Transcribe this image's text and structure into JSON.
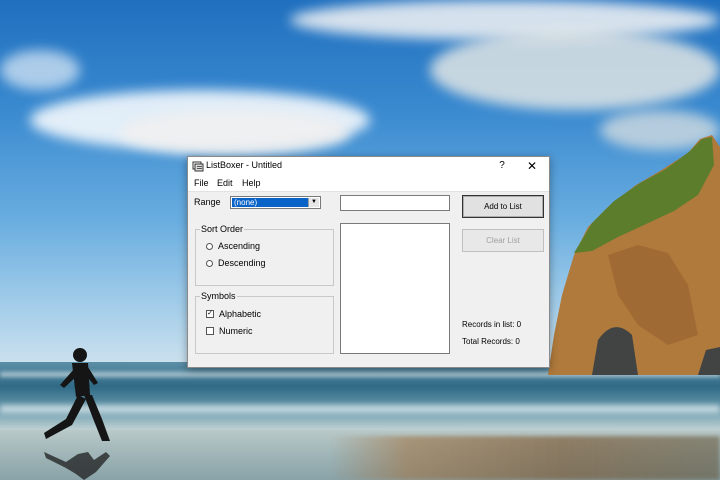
{
  "window": {
    "title": "ListBoxer - Untitled",
    "help_button": "?",
    "close_button": "✕"
  },
  "menu": [
    "File",
    "Edit",
    "Help"
  ],
  "range": {
    "label": "Range",
    "selected": "(none)",
    "arrow": "▼"
  },
  "sort_order": {
    "title": "Sort Order",
    "options": [
      "Ascending",
      "Descending"
    ]
  },
  "symbols": {
    "title": "Symbols",
    "options": [
      {
        "label": "Alphabetic",
        "checked": true,
        "mark": "✓"
      },
      {
        "label": "Numeric",
        "checked": false,
        "mark": ""
      }
    ]
  },
  "buttons": {
    "add": "Add to List",
    "clear": "Clear List"
  },
  "stats": {
    "records_in_list": "Records in list: 0",
    "total_records": "Total Records: 0"
  }
}
